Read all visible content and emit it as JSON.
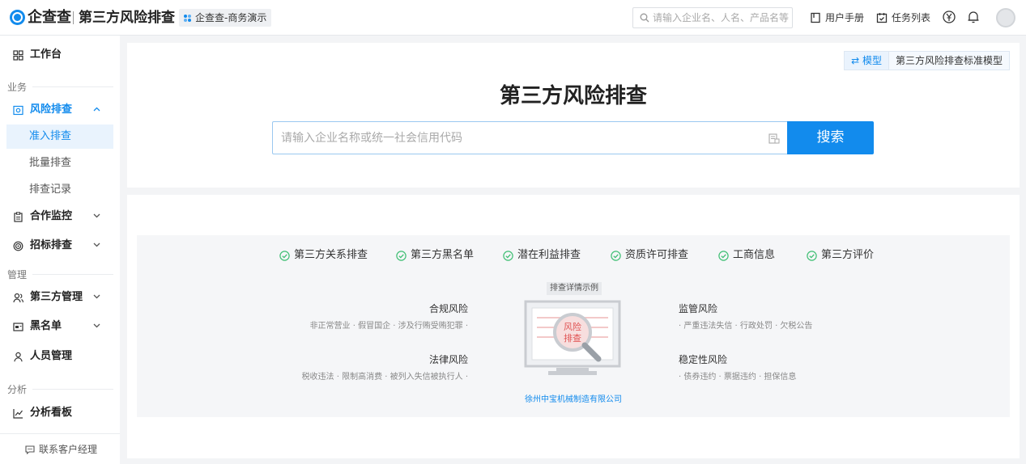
{
  "topbar": {
    "logo": "企查查",
    "app_title": "第三方风险排查",
    "workspace": "企查查-商务演示",
    "search_placeholder": "请输入企业名、人名、产品名等",
    "manual": "用户手册",
    "tasks": "任务列表"
  },
  "sidebar": {
    "workbench": "工作台",
    "section_business": "业务",
    "risk_check": "风险排查",
    "sub_admission": "准入排查",
    "sub_batch": "批量排查",
    "sub_records": "排查记录",
    "coop_monitor": "合作监控",
    "bid_check": "招标排查",
    "section_manage": "管理",
    "third_party_mgmt": "第三方管理",
    "blacklist": "黑名单",
    "people_mgmt": "人员管理",
    "section_analysis": "分析",
    "analysis_board": "分析看板",
    "contact": "联系客户经理"
  },
  "main": {
    "model_label": "⇄ 模型",
    "model_name": "第三方风险排查标准模型",
    "title": "第三方风险排查",
    "search_placeholder": "请输入企业名称或统一社会信用代码",
    "search_button": "搜索"
  },
  "features": [
    "第三方关系排查",
    "第三方黑名单",
    "潜在利益排查",
    "资质许可排查",
    "工商信息",
    "第三方评价"
  ],
  "demo": {
    "label": "排查详情示例",
    "illus_text_1": "风险",
    "illus_text_2": "排查",
    "company": "徐州中宝机械制造有限公司",
    "compliance_title": "合规风险",
    "compliance_desc": "非正常营业 · 假冒国企 · 涉及行贿受贿犯罪 ·",
    "legal_title": "法律风险",
    "legal_desc": "税收违法 · 限制高消费 · 被列入失信被执行人 ·",
    "regulatory_title": "监管风险",
    "regulatory_desc": "· 严重违法失信 · 行政处罚 · 欠税公告",
    "stability_title": "稳定性风险",
    "stability_desc": "· 债券违约 · 票据违约 · 担保信息"
  },
  "colors": {
    "accent": "#128bed",
    "check": "#3fbf74"
  }
}
